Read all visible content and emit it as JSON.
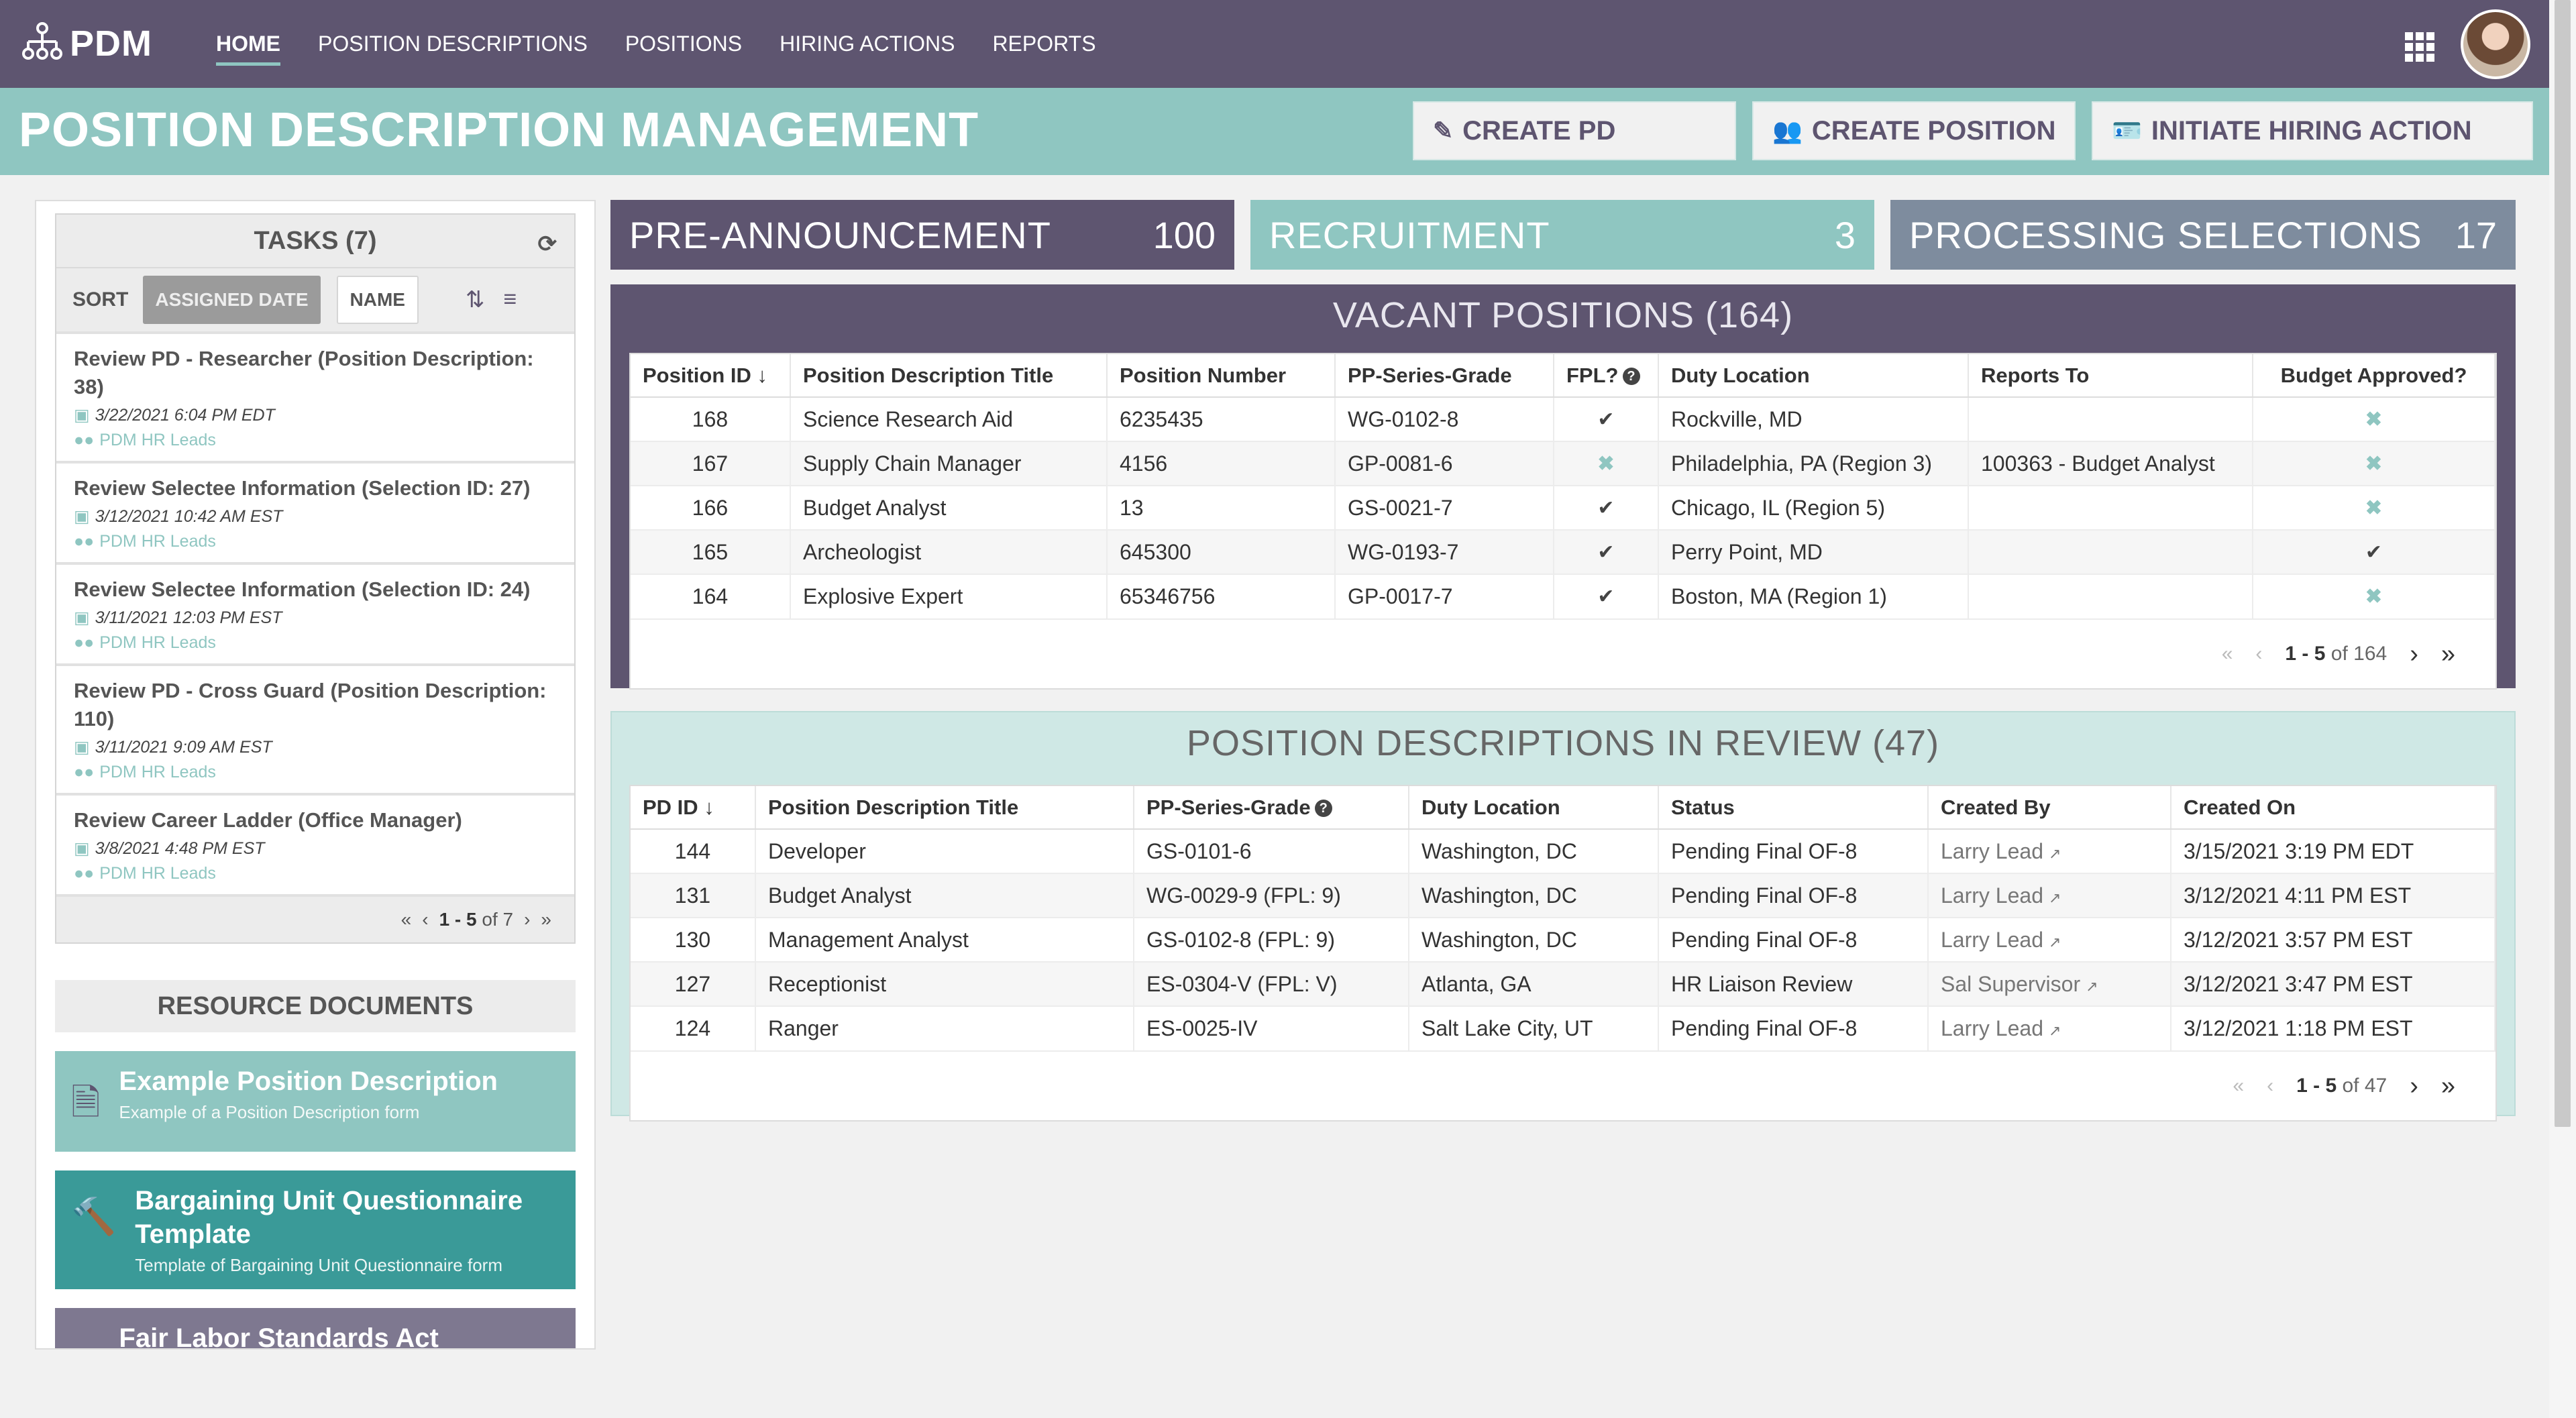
{
  "nav": {
    "logo_text": "PDM",
    "links": [
      {
        "label": "HOME"
      },
      {
        "label": "POSITION DESCRIPTIONS"
      },
      {
        "label": "POSITIONS"
      },
      {
        "label": "HIRING ACTIONS"
      },
      {
        "label": "REPORTS"
      }
    ]
  },
  "header": {
    "title": "POSITION DESCRIPTION MANAGEMENT",
    "buttons": {
      "create_pd": "CREATE PD",
      "create_position": "CREATE POSITION",
      "initiate_hiring": "INITIATE HIRING ACTION"
    }
  },
  "tasks": {
    "title": "TASKS (7)",
    "sort_label": "SORT",
    "sort_assigned": "ASSIGNED DATE",
    "sort_name": "NAME",
    "items": [
      {
        "title": "Review PD - Researcher (Position Description: 38)",
        "date": "3/22/2021 6:04 PM EDT",
        "group": "PDM HR Leads"
      },
      {
        "title": "Review Selectee Information (Selection ID: 27)",
        "date": "3/12/2021 10:42 AM EST",
        "group": "PDM HR Leads"
      },
      {
        "title": "Review Selectee Information (Selection ID: 24)",
        "date": "3/11/2021 12:03 PM EST",
        "group": "PDM HR Leads"
      },
      {
        "title": "Review PD - Cross Guard (Position Description: 110)",
        "date": "3/11/2021 9:09 AM EST",
        "group": "PDM HR Leads"
      },
      {
        "title": "Review Career Ladder (Office Manager)",
        "date": "3/8/2021 4:48 PM EST",
        "group": "PDM HR Leads"
      }
    ],
    "pager": {
      "range": "1 - 5",
      "total": "of 7"
    }
  },
  "resources": {
    "title": "RESOURCE DOCUMENTS",
    "items": [
      {
        "title": "Example Position Description",
        "desc": "Example of a Position Description form"
      },
      {
        "title": "Bargaining Unit Questionnaire Template",
        "desc": "Template of Bargaining Unit Questionnaire form"
      },
      {
        "title": "Fair Labor Standards Act Template",
        "desc": ""
      }
    ]
  },
  "stats": {
    "pre_announcement": {
      "label": "PRE-ANNOUNCEMENT",
      "count": "100"
    },
    "recruitment": {
      "label": "RECRUITMENT",
      "count": "3"
    },
    "processing": {
      "label": "PROCESSING SELECTIONS",
      "count": "17"
    }
  },
  "vacant": {
    "title": "VACANT POSITIONS (164)",
    "columns": [
      "Position ID",
      "Position Description Title",
      "Position Number",
      "PP-Series-Grade",
      "FPL?",
      "Duty Location",
      "Reports To",
      "Budget Approved?"
    ],
    "rows": [
      {
        "id": "168",
        "title": "Science Research Aid",
        "number": "6235435",
        "grade": "WG-0102-8",
        "fpl": "check",
        "location": "Rockville, MD",
        "reports_to": "",
        "budget": "x"
      },
      {
        "id": "167",
        "title": "Supply Chain Manager",
        "number": "4156",
        "grade": "GP-0081-6",
        "fpl": "x",
        "location": "Philadelphia, PA (Region 3)",
        "reports_to": "100363 - Budget Analyst",
        "budget": "x"
      },
      {
        "id": "166",
        "title": "Budget Analyst",
        "number": "13",
        "grade": "GS-0021-7",
        "fpl": "check",
        "location": "Chicago, IL (Region 5)",
        "reports_to": "",
        "budget": "x"
      },
      {
        "id": "165",
        "title": "Archeologist",
        "number": "645300",
        "grade": "WG-0193-7",
        "fpl": "check",
        "location": "Perry Point, MD",
        "reports_to": "",
        "budget": "check"
      },
      {
        "id": "164",
        "title": "Explosive Expert",
        "number": "65346756",
        "grade": "GP-0017-7",
        "fpl": "check",
        "location": "Boston, MA (Region 1)",
        "reports_to": "",
        "budget": "x"
      }
    ],
    "pager": {
      "range": "1 - 5",
      "total": "of 164"
    }
  },
  "review": {
    "title": "POSITION DESCRIPTIONS IN REVIEW (47)",
    "columns": [
      "PD ID",
      "Position Description Title",
      "PP-Series-Grade",
      "Duty Location",
      "Status",
      "Created By",
      "Created On"
    ],
    "rows": [
      {
        "id": "144",
        "title": "Developer",
        "grade": "GS-0101-6",
        "location": "Washington, DC",
        "status": "Pending Final OF-8",
        "created_by": "Larry Lead",
        "created_on": "3/15/2021 3:19 PM EDT"
      },
      {
        "id": "131",
        "title": "Budget Analyst",
        "grade": "WG-0029-9 (FPL: 9)",
        "location": "Washington, DC",
        "status": "Pending Final OF-8",
        "created_by": "Larry Lead",
        "created_on": "3/12/2021 4:11 PM EST"
      },
      {
        "id": "130",
        "title": "Management Analyst",
        "grade": "GS-0102-8 (FPL: 9)",
        "location": "Washington, DC",
        "status": "Pending Final OF-8",
        "created_by": "Larry Lead",
        "created_on": "3/12/2021 3:57 PM EST"
      },
      {
        "id": "127",
        "title": "Receptionist",
        "grade": "ES-0304-V (FPL: V)",
        "location": "Atlanta, GA",
        "status": "HR Liaison Review",
        "created_by": "Sal Supervisor",
        "created_on": "3/12/2021 3:47 PM EST"
      },
      {
        "id": "124",
        "title": "Ranger",
        "grade": "ES-0025-IV",
        "location": "Salt Lake City, UT",
        "status": "Pending Final OF-8",
        "created_by": "Larry Lead",
        "created_on": "3/12/2021 1:18 PM EST"
      }
    ],
    "pager": {
      "range": "1 - 5",
      "total": "of 47"
    }
  },
  "colors": {
    "nav": "#5e5570",
    "accent": "#8fc6c1",
    "teal_dark": "#3a9a98",
    "slate": "#7e8c9e"
  }
}
